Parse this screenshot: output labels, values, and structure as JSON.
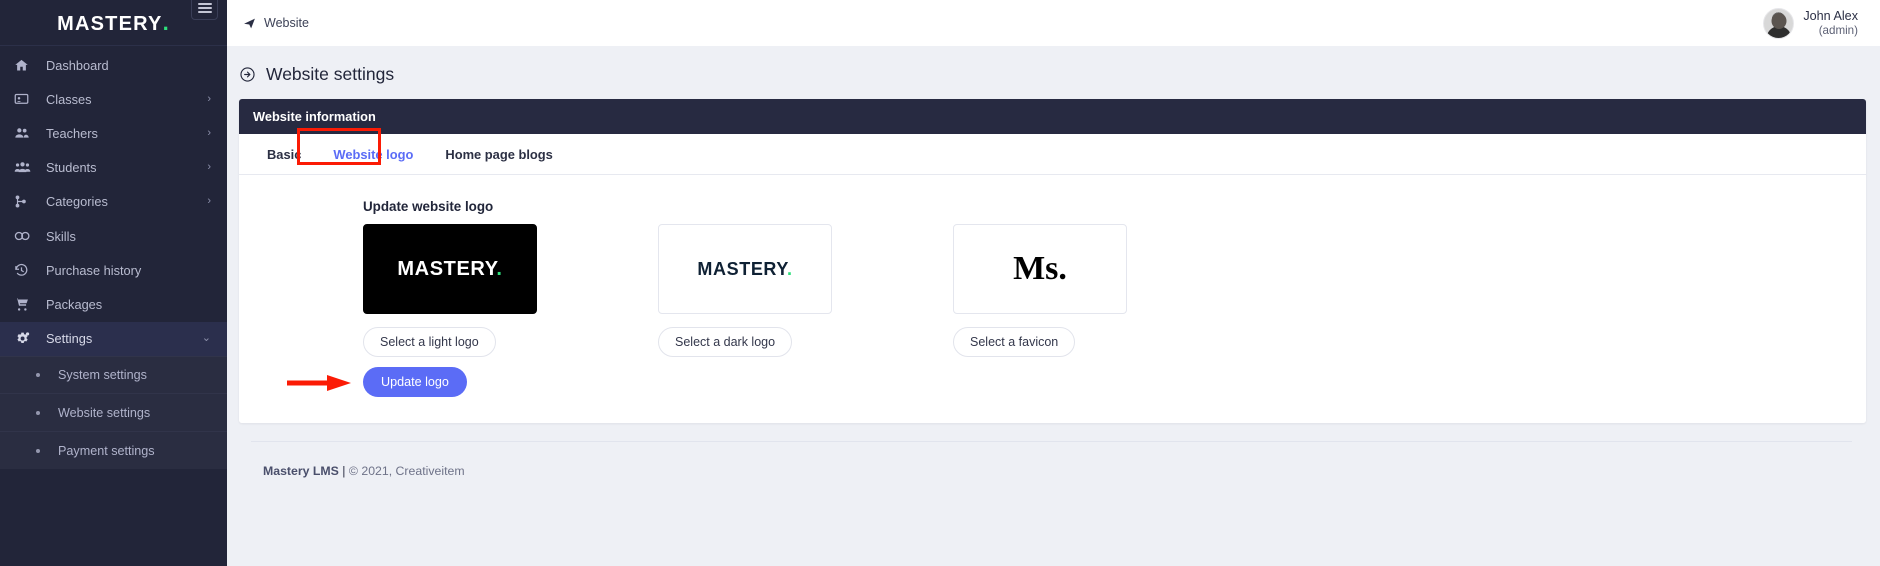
{
  "brand": {
    "name": "MASTERY",
    "dot": "."
  },
  "sidebar": {
    "items": [
      {
        "label": "Dashboard",
        "icon": "home-icon",
        "chevron": "",
        "active": false
      },
      {
        "label": "Classes",
        "icon": "classes-icon",
        "chevron": "›",
        "active": false
      },
      {
        "label": "Teachers",
        "icon": "teachers-icon",
        "chevron": "›",
        "active": false
      },
      {
        "label": "Students",
        "icon": "students-icon",
        "chevron": "›",
        "active": false
      },
      {
        "label": "Categories",
        "icon": "categories-icon",
        "chevron": "›",
        "active": false
      },
      {
        "label": "Skills",
        "icon": "skills-icon",
        "chevron": "",
        "active": false
      },
      {
        "label": "Purchase history",
        "icon": "history-icon",
        "chevron": "",
        "active": false
      },
      {
        "label": "Packages",
        "icon": "cart-icon",
        "chevron": "",
        "active": false
      },
      {
        "label": "Settings",
        "icon": "gear-icon",
        "chevron": "⌄",
        "active": true
      }
    ],
    "subitems": [
      {
        "label": "System settings"
      },
      {
        "label": "Website settings"
      },
      {
        "label": "Payment settings"
      }
    ]
  },
  "topbar": {
    "breadcrumb": "Website",
    "breadcrumb_icon": "paper-plane-icon",
    "user_name": "John Alex",
    "user_role": "(admin)",
    "menu_toggle_icon": "hamburger-icon"
  },
  "page": {
    "title": "Website settings",
    "title_icon": "arrow-circle-right-icon"
  },
  "card": {
    "header": "Website information",
    "tabs": [
      {
        "label": "Basic",
        "active": false
      },
      {
        "label": "Website logo",
        "active": true
      },
      {
        "label": "Home page blogs",
        "active": false
      }
    ],
    "section_title": "Update website logo",
    "logos": [
      {
        "kind": "light",
        "preview_text": "MASTERY",
        "preview_dot": ".",
        "button_label": "Select a light logo"
      },
      {
        "kind": "dark",
        "preview_text": "MASTERY",
        "preview_dot": ".",
        "button_label": "Select a dark logo"
      },
      {
        "kind": "favicon",
        "preview_text": "Ms.",
        "preview_dot": "",
        "button_label": "Select a favicon"
      }
    ],
    "update_button": "Update logo"
  },
  "footer": {
    "product": "Mastery LMS",
    "separator": " | ",
    "copyright": "© 2021, Creativeitem"
  },
  "colors": {
    "sidebar_bg": "#222539",
    "sidebar_active": "#2b2f4d",
    "card_header_bg": "#272a41",
    "accent_blue": "#5b6cf6",
    "brand_green": "#2ee07c",
    "annotation_red": "#fb1b05",
    "page_bg": "#eef0f5"
  }
}
